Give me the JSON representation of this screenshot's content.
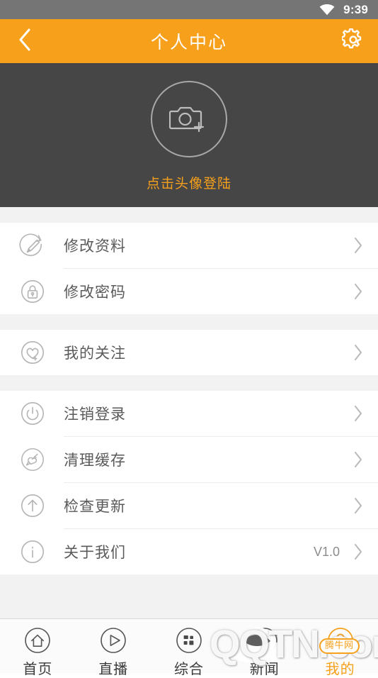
{
  "statusbar": {
    "time": "9:39",
    "wifi_icon": "wifi-icon",
    "background": "#757575"
  },
  "header": {
    "title": "个人中心",
    "back_icon": "chevron-left-icon",
    "settings_icon": "gear-icon",
    "background": "#f7a01c",
    "text_color": "#ffffff"
  },
  "profile": {
    "avatar_icon": "camera-add-icon",
    "login_hint": "点击头像登陆",
    "hint_color": "#f7a01c",
    "background": "#464646"
  },
  "menu": {
    "groups": [
      {
        "rows": [
          {
            "icon": "pencil-edit-icon",
            "label": "修改资料",
            "value": "",
            "chevron": "chevron-right-icon"
          },
          {
            "icon": "lock-icon",
            "label": "修改密码",
            "value": "",
            "chevron": "chevron-right-icon"
          }
        ]
      },
      {
        "rows": [
          {
            "icon": "heart-add-icon",
            "label": "我的关注",
            "value": "",
            "chevron": "chevron-right-icon"
          }
        ]
      },
      {
        "rows": [
          {
            "icon": "power-icon",
            "label": "注销登录",
            "value": "",
            "chevron": "chevron-right-icon"
          },
          {
            "icon": "broom-icon",
            "label": "清理缓存",
            "value": "",
            "chevron": "chevron-right-icon"
          },
          {
            "icon": "arrow-up-circle-icon",
            "label": "检查更新",
            "value": "",
            "chevron": "chevron-right-icon"
          },
          {
            "icon": "info-icon",
            "label": "关于我们",
            "value": "V1.0",
            "chevron": "chevron-right-icon"
          }
        ]
      }
    ]
  },
  "tabbar": {
    "active_color": "#f7a01c",
    "inactive_color": "#3a3a3a",
    "tabs": [
      {
        "icon": "home-icon",
        "label": "首页",
        "active": false
      },
      {
        "icon": "play-circle-icon",
        "label": "直播",
        "active": false
      },
      {
        "icon": "grid-icon",
        "label": "综合",
        "active": false
      },
      {
        "icon": "news-document-icon",
        "label": "新闻",
        "active": false
      },
      {
        "icon": "user-icon",
        "label": "我的",
        "active": true
      }
    ]
  },
  "watermark": {
    "text": "QQTN.com",
    "badge": "腾牛网",
    "logo_icon": "qqtn-logo-icon"
  }
}
